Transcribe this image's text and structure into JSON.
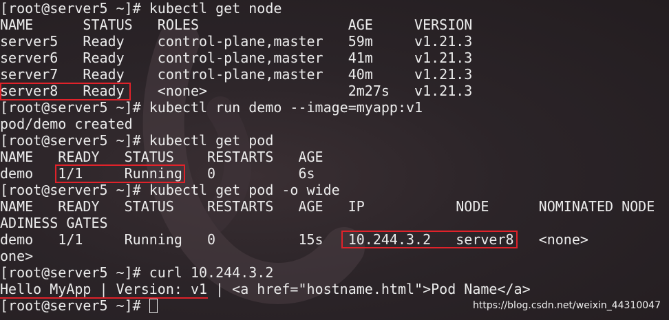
{
  "terminal": {
    "lines": [
      "[root@server5 ~]# kubectl get node",
      "NAME      STATUS   ROLES                  AGE     VERSION",
      "server5   Ready    control-plane,master   59m     v1.21.3",
      "server6   Ready    control-plane,master   41m     v1.21.3",
      "server7   Ready    control-plane,master   40m     v1.21.3",
      "server8   Ready    <none>                 2m27s   v1.21.3",
      "[root@server5 ~]# kubectl run demo --image=myapp:v1",
      "pod/demo created",
      "[root@server5 ~]# kubectl get pod",
      "NAME   READY   STATUS    RESTARTS   AGE",
      "demo   1/1     Running   0          6s",
      "[root@server5 ~]# kubectl get pod -o wide",
      "NAME   READY   STATUS    RESTARTS   AGE   IP           NODE      NOMINATED NODE",
      "ADINESS GATES",
      "demo   1/1     Running   0          15s   10.244.3.2   server8   <none>",
      "one>",
      "[root@server5 ~]# curl 10.244.3.2",
      "Hello MyApp | Version: v1 | <a href=\"hostname.html\">Pod Name</a>",
      "[root@server5 ~]# "
    ]
  },
  "highlight_color": "#e0222a",
  "watermark": "https://blog.csdn.net/weixin_44310047"
}
